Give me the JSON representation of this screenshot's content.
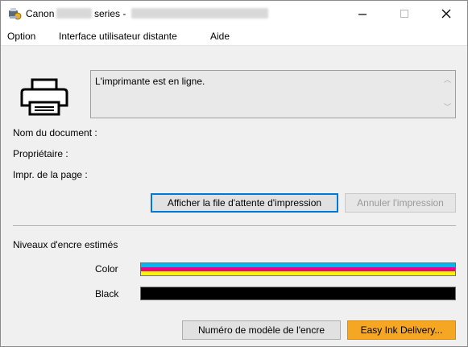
{
  "titlebar": {
    "brand": "Canon",
    "series": "series -",
    "minimize_glyph": "—",
    "maximize_glyph": "☐",
    "close_glyph": "✕"
  },
  "menu": {
    "items": [
      {
        "label": "Option"
      },
      {
        "label": "Interface utilisateur distante"
      },
      {
        "label": "Aide"
      }
    ]
  },
  "status": {
    "message": "L'imprimante est en ligne."
  },
  "job_info": {
    "document_name_label": "Nom du document :",
    "owner_label": "Propriétaire :",
    "page_label": "Impr. de la page :"
  },
  "actions": {
    "show_queue_label": "Afficher la file d'attente d'impression",
    "cancel_print_label": "Annuler l'impression"
  },
  "ink": {
    "section_title": "Niveaux d'encre estimés",
    "cartridges": [
      {
        "name": "Color",
        "colors": [
          "#00b7ef",
          "#ec008c",
          "#fff200"
        ]
      },
      {
        "name": "Black",
        "colors": [
          "#000000"
        ]
      }
    ]
  },
  "footer": {
    "ink_model_label": "Numéro de modèle de l'encre",
    "easy_ink_label": "Easy Ink Delivery..."
  },
  "icons": {
    "app": "canon-printer-app-icon",
    "printer": "printer-icon"
  }
}
